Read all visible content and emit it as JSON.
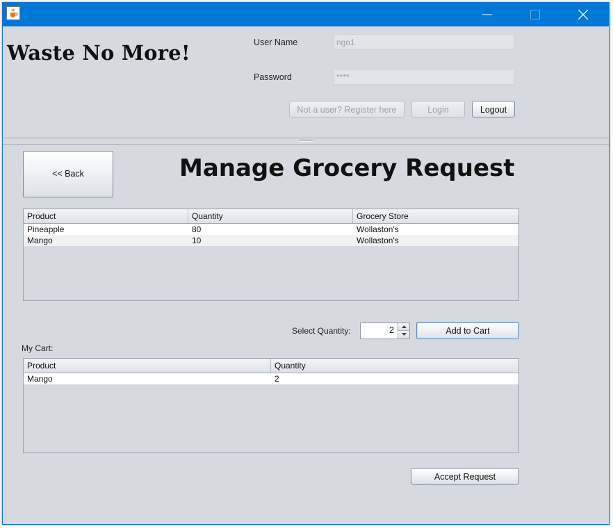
{
  "window": {
    "icon": "java-cup-icon",
    "controls": {
      "minimize": "minimize-icon",
      "maximize": "maximize-icon",
      "close": "close-icon"
    }
  },
  "header": {
    "brand": "Waste No More!",
    "username_label": "User Name",
    "username_value": "ngo1",
    "password_label": "Password",
    "password_value": "****",
    "register_label": "Not a user? Register here",
    "login_label": "Login",
    "logout_label": "Logout"
  },
  "main": {
    "back_label": "<< Back",
    "title": "Manage Grocery Request",
    "requests_table": {
      "columns": [
        "Product",
        "Quantity",
        "Grocery Store"
      ],
      "rows": [
        [
          "Pineapple",
          "80",
          "Wollaston's"
        ],
        [
          "Mango",
          "10",
          "Wollaston's"
        ]
      ]
    },
    "select_quantity_label": "Select Quantity:",
    "quantity_value": "2",
    "add_to_cart_label": "Add to Cart",
    "cart_label": "My Cart:",
    "cart_table": {
      "columns": [
        "Product",
        "Quantity"
      ],
      "rows": [
        [
          "Mango",
          "2"
        ]
      ]
    },
    "accept_label": "Accept Request"
  },
  "colors": {
    "titlebar": "#0078d7",
    "background": "#d6d9df"
  }
}
